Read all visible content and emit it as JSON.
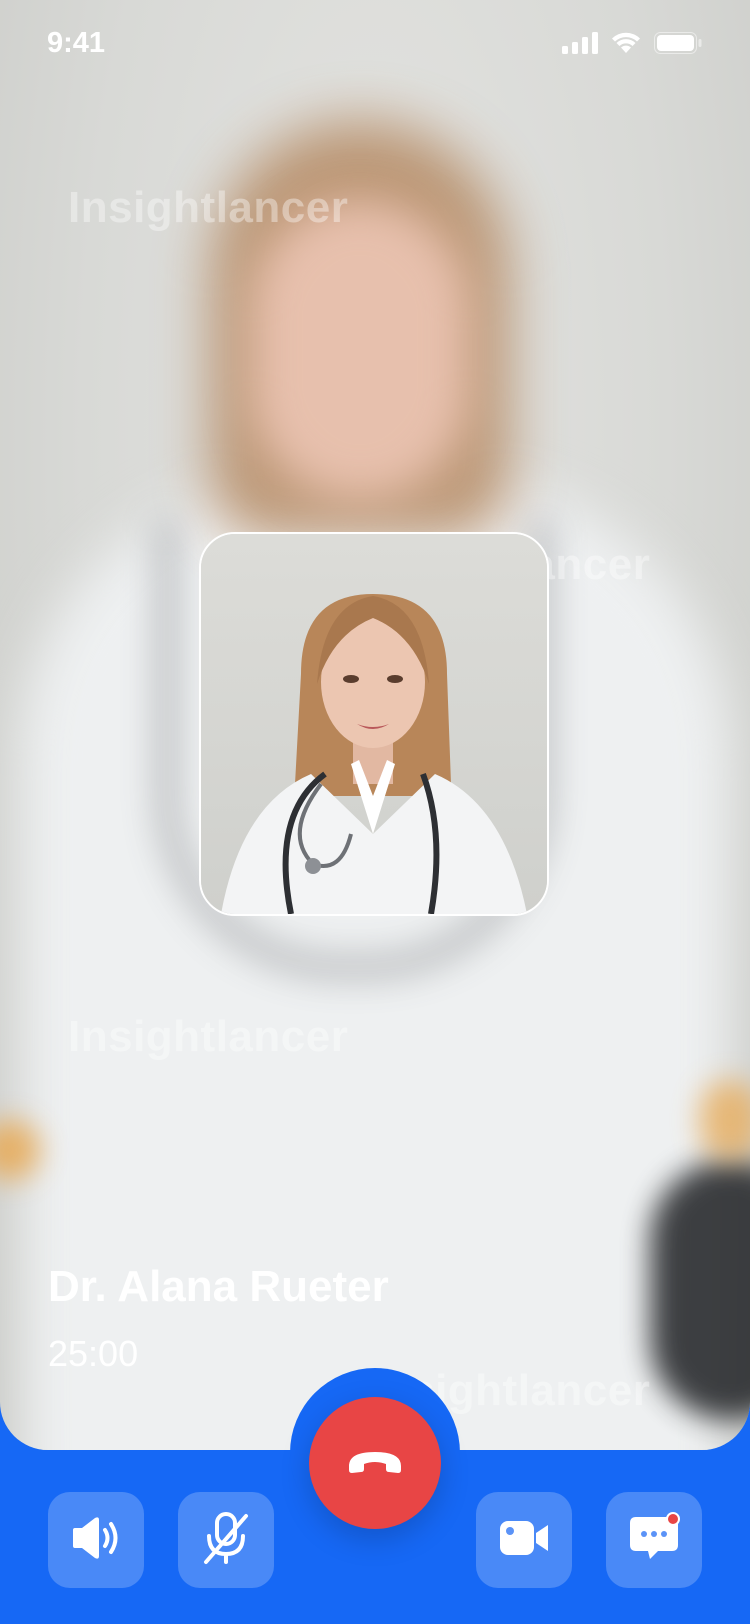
{
  "status_bar": {
    "time": "9:41",
    "icons": [
      "cellular-signal-icon",
      "wifi-icon",
      "battery-icon"
    ]
  },
  "watermarks": [
    "Insightlancer",
    "Insightlancer",
    "Insightlancer",
    "Insightlancer"
  ],
  "remote_video": {
    "description_icon": "remote-video-feed"
  },
  "self_view": {
    "icon": "self-view-video"
  },
  "caller": {
    "name": "Dr. Alana Rueter",
    "duration": "25:00"
  },
  "controls": {
    "speaker_icon": "speaker-icon",
    "mute_icon": "microphone-off-icon",
    "end_call_icon": "phone-hangup-icon",
    "video_icon": "video-camera-icon",
    "chat_icon": "chat-bubble-icon",
    "chat_has_unread": true
  },
  "colors": {
    "primary": "#1668f5",
    "end_call": "#e84545",
    "control_bg": "rgba(255,255,255,0.22)",
    "text": "#ffffff"
  }
}
